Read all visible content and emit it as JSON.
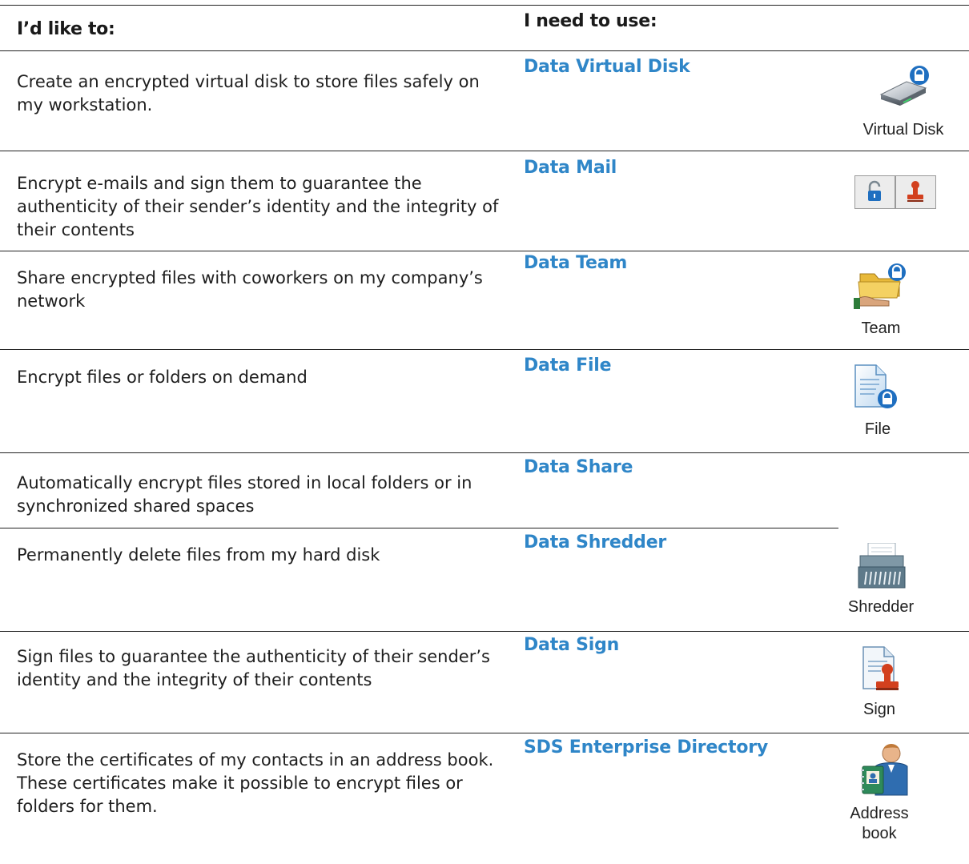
{
  "header": {
    "col_task": "I’d like to:",
    "col_product": "I need to use:"
  },
  "rows": [
    {
      "task": "Create an encrypted virtual disk to store files safely on my workstation.",
      "product": "Data Virtual Disk",
      "icon_label": "Virtual Disk",
      "icon": "virtual-disk-icon"
    },
    {
      "task": "Encrypt e-mails and sign them to guarantee the authenticity of their sender’s identity and the integrity of their contents",
      "product": "Data Mail",
      "icon_label": "",
      "icon": "mail-encrypt-sign-icons"
    },
    {
      "task": "Share encrypted files with coworkers on my company’s network",
      "product": "Data Team",
      "icon_label": "Team",
      "icon": "team-icon"
    },
    {
      "task": "Encrypt files or folders on demand",
      "product": "Data File",
      "icon_label": "File",
      "icon": "file-icon"
    },
    {
      "task": "Automatically encrypt files stored in local folders or in synchronized shared spaces",
      "product": "Data Share",
      "icon_label": "",
      "icon": ""
    },
    {
      "task": "Permanently delete files from my hard disk",
      "product": "Data Shredder",
      "icon_label": "Shredder",
      "icon": "shredder-icon"
    },
    {
      "task": "Sign files to guarantee the authenticity of their sender’s identity and the integrity of their contents",
      "product": "Data Sign",
      "icon_label": "Sign",
      "icon": "sign-icon"
    },
    {
      "task": "Store the certificates of my contacts in an address book. These certificates make it possible to encrypt files or folders for them.",
      "product": "SDS Enterprise Directory",
      "icon_label": "Address book",
      "icon": "address-book-icon"
    }
  ],
  "colors": {
    "link": "#2f86c8",
    "rule": "#222222",
    "lock_blue": "#1f6fc0"
  }
}
